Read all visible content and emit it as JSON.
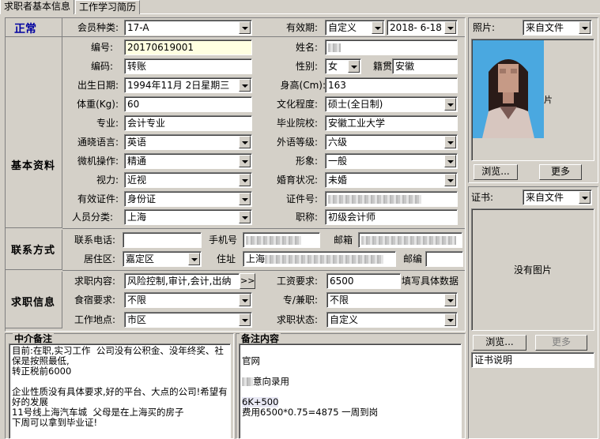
{
  "tabs": [
    {
      "label": "求职者基本信息"
    },
    {
      "label": "工作学习简历"
    }
  ],
  "status": "正常",
  "sections": {
    "basic": "基本资料",
    "contact": "联系方式",
    "job": "求职信息"
  },
  "member": {
    "type_label": "会员种类:",
    "type_value": "17-A",
    "validity_label": "有效期:",
    "validity_value": "自定义",
    "validity_date": "2018- 6-18"
  },
  "basic": {
    "id_label": "编号:",
    "id_value": "20170619001",
    "name_label": "姓名:",
    "code_label": "编码:",
    "code_value": "转账",
    "gender_label": "性别:",
    "gender_value": "女",
    "native_label": "籍贯",
    "native_value": "安徽",
    "birth_label": "出生日期:",
    "birth_value": "1994年11月 2日星期三",
    "height_label": "身高(Cm):",
    "height_value": "163",
    "weight_label": "体重(Kg):",
    "weight_value": "60",
    "edu_label": "文化程度:",
    "edu_value": "硕士(全日制)",
    "major_label": "专业:",
    "major_value": "会计专业",
    "school_label": "毕业院校:",
    "school_value": "安徽工业大学",
    "lang_label": "通晓语言:",
    "lang_value": "英语",
    "lang_level_label": "外语等级:",
    "lang_level_value": "六级",
    "computer_label": "微机操作:",
    "computer_value": "精通",
    "appearance_label": "形象:",
    "appearance_value": "一般",
    "vision_label": "视力:",
    "vision_value": "近视",
    "marital_label": "婚育状况:",
    "marital_value": "未婚",
    "idtype_label": "有效证件:",
    "idtype_value": "身份证",
    "idno_label": "证件号:",
    "category_label": "人员分类:",
    "category_value": "上海",
    "title_label": "职称:",
    "title_value": "初级会计师"
  },
  "contact": {
    "phone_label": "联系电话:",
    "mobile_label": "手机号",
    "email_label": "邮箱",
    "district_label": "居住区:",
    "district_value": "嘉定区",
    "address_label": "住址",
    "address_value": "上海",
    "zip_label": "邮编"
  },
  "job": {
    "content_label": "求职内容:",
    "content_value": "风险控制,审计,会计,出纳",
    "more_btn": ">>",
    "salary_label": "工资要求:",
    "salary_value": "6500",
    "salary_hint": "填写具体数据",
    "board_label": "食宿要求:",
    "board_value": "不限",
    "parttime_label": "专/兼职:",
    "parttime_value": "不限",
    "location_label": "工作地点:",
    "location_value": "市区",
    "state_label": "求职状态:",
    "state_value": "自定义"
  },
  "notes": {
    "agent_title": "中介备注",
    "agent_text": "目前:在职,实习工作  公司没有公积金、没年终奖、社保是按照最低,\n转正税前6000\n\n企业性质没有具体要求,好的平台、大点的公司!希望有好的发展\n11号线上海汽车城  父母是在上海买的房子\n下周可以拿到毕业证!",
    "remark_title": "备注内容",
    "remark_line1": "官网",
    "remark_line2": "意向录用",
    "remark_line3": "6K+500",
    "remark_line4": "费用6500*0.75=4875 一周到岗"
  },
  "photo": {
    "label": "照片:",
    "source": "来自文件",
    "browse": "浏览...",
    "more": "更多"
  },
  "cert": {
    "label": "证书:",
    "source": "来自文件",
    "empty": "没有图片",
    "browse": "浏览...",
    "more": "更多",
    "desc": "证书说明"
  }
}
